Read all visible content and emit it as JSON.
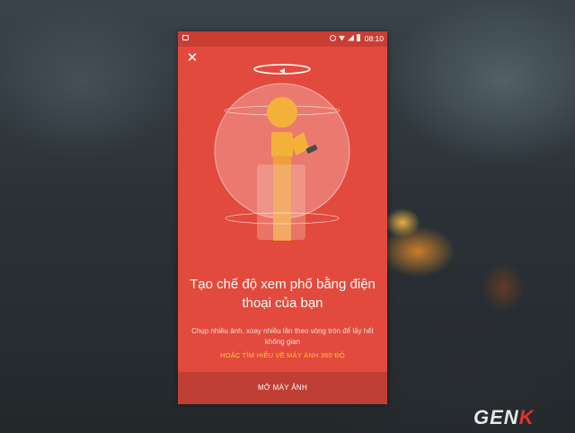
{
  "status_bar": {
    "time": "08:10",
    "icons": [
      "notification-icon",
      "alarm-icon",
      "wifi-icon",
      "signal-icon",
      "battery-icon"
    ]
  },
  "close_icon": "close-icon",
  "intro": {
    "title": "Tạo chế độ xem phố bằng điện thoại của bạn",
    "description": "Chụp nhiều ảnh, xoay nhiều lần theo vòng tròn để lấy hết không gian",
    "learn_more_link": "HOẶC TÌM HIỂU VỀ MÁY ẢNH 360 ĐỘ",
    "open_camera_button": "MỞ MÁY ẢNH"
  },
  "colors": {
    "screen_bg": "#e24a3d",
    "status_bar": "#c93e33",
    "button_bg": "#bf3f35",
    "link": "#ffc83a",
    "figure": "#f3b13a"
  },
  "watermark": {
    "prefix": "GEN",
    "accent": "K"
  }
}
